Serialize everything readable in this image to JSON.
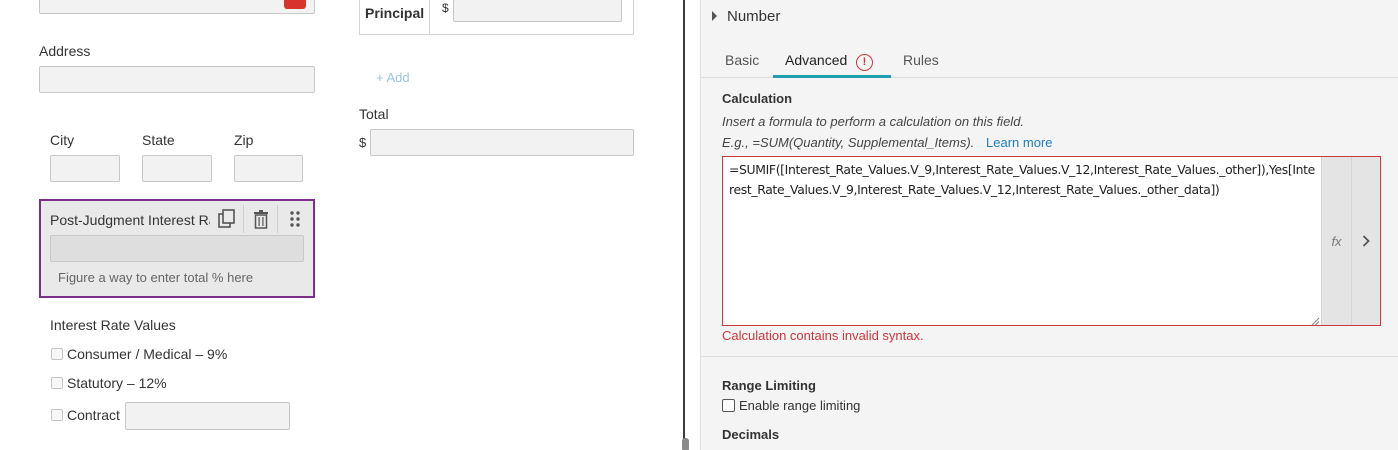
{
  "form": {
    "address_label": "Address",
    "city_label": "City",
    "state_label": "State",
    "zip_label": "Zip",
    "interest_field_label": "Post-Judgment Interest Rate %",
    "interest_field_hint": "Figure a way to enter total % here",
    "interest_values_label": "Interest Rate Values",
    "options": [
      {
        "label": "Consumer / Medical – 9%"
      },
      {
        "label": "Statutory – 12%"
      },
      {
        "label": "Contract"
      }
    ],
    "principal_label": "Principal",
    "currency_symbol": "$",
    "add_label": "+ Add",
    "total_label": "Total"
  },
  "panel": {
    "field_type": "Number",
    "tabs": [
      {
        "label": "Basic"
      },
      {
        "label": "Advanced"
      },
      {
        "label": "Rules"
      }
    ],
    "error_badge": "!",
    "calculation": {
      "title": "Calculation",
      "description": "Insert a formula to perform a calculation on this field.",
      "example": "E.g., =SUM(Quantity, Supplemental_Items).",
      "learn_more": "Learn more",
      "formula": "=SUMIF([Interest_Rate_Values.V_9,Interest_Rate_Values.V_12,Interest_Rate_Values._other]),Yes[Interest_Rate_Values.V_9,Interest_Rate_Values.V_12,Interest_Rate_Values._other_data])",
      "fx_label": "fx",
      "error": "Calculation contains invalid syntax."
    },
    "range_limiting": {
      "title": "Range Limiting",
      "checkbox_label": "Enable range limiting"
    },
    "decimals_title": "Decimals"
  },
  "colors": {
    "accent": "#1f9fb0",
    "error": "#c8383e",
    "selected_border": "#7b2e8a",
    "add_link": "#9fc4e0"
  }
}
